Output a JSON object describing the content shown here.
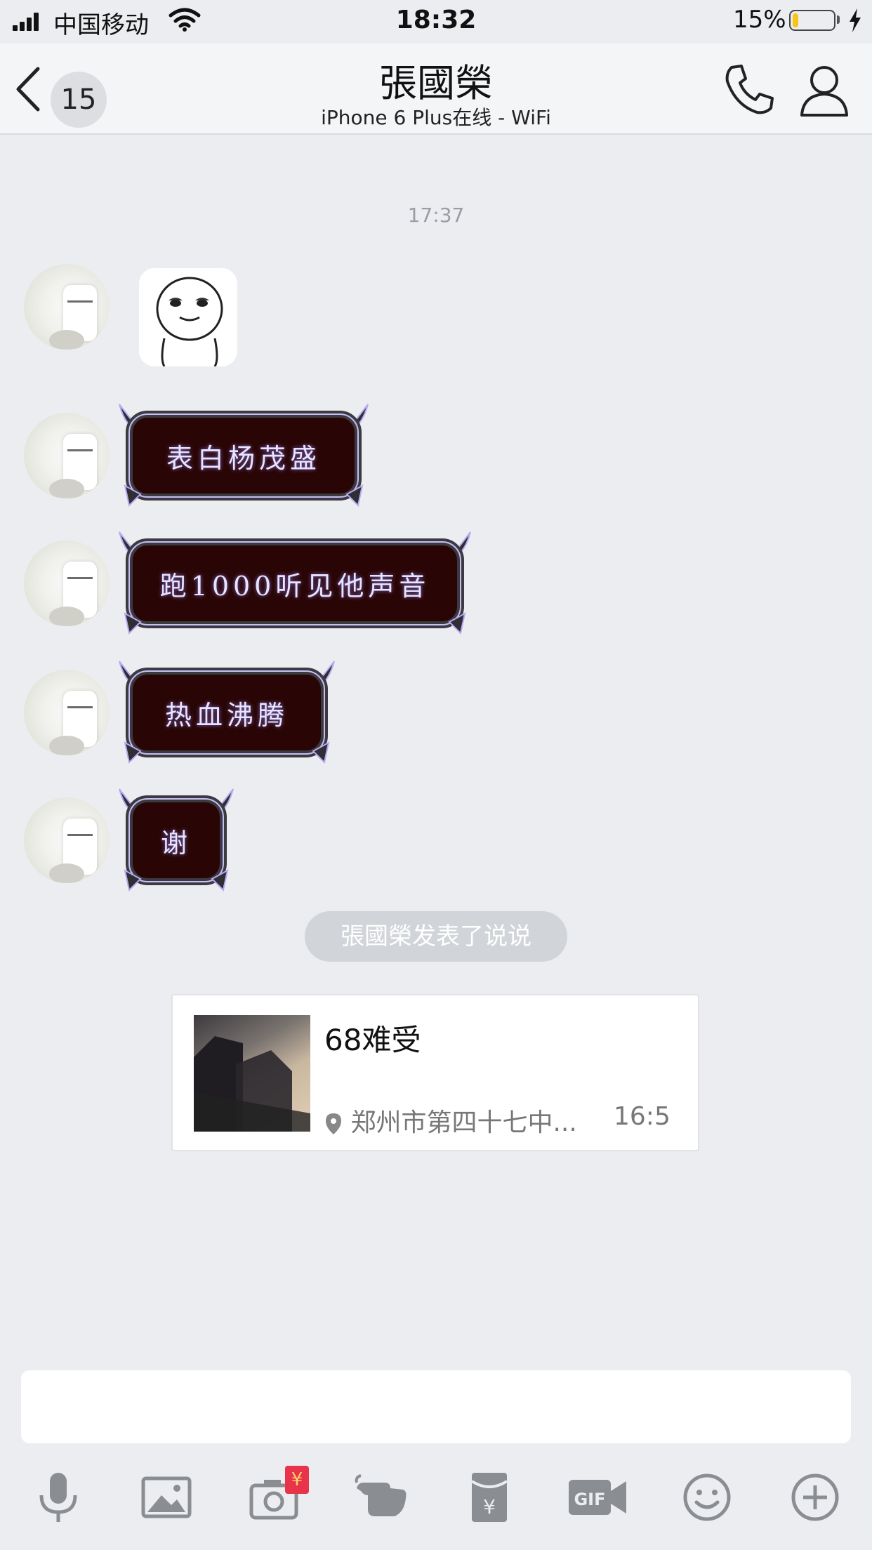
{
  "status_bar": {
    "carrier": "中国移动",
    "time": "18:32",
    "battery_percent": "15%",
    "signal_bars": 4,
    "battery_level": 0.15,
    "charging": true
  },
  "nav": {
    "back_icon": "chevron-left-icon",
    "unread_count": "15",
    "contact_name": "張國榮",
    "contact_status": "iPhone 6 Plus在线 - WiFi",
    "call_icon": "phone-icon",
    "profile_icon": "person-icon"
  },
  "chat": {
    "time_divider": "17:37",
    "messages": [
      {
        "type": "sticker",
        "sender": "張國榮",
        "sticker": "smiling-face-sticker"
      },
      {
        "type": "text",
        "sender": "張國榮",
        "text": "表白杨茂盛"
      },
      {
        "type": "text",
        "sender": "張國榮",
        "text": "跑1000听见他声音"
      },
      {
        "type": "text",
        "sender": "張國榮",
        "text": "热血沸腾"
      },
      {
        "type": "text",
        "sender": "張國榮",
        "text": "谢"
      }
    ],
    "system_notice": "張國榮发表了说说",
    "post_card": {
      "title": "68难受",
      "location": "郑州市第四十七中...",
      "time": "16:5"
    }
  },
  "input": {
    "value": "",
    "toolbar": [
      {
        "icon": "microphone-icon"
      },
      {
        "icon": "image-icon"
      },
      {
        "icon": "camera-icon",
        "badge": "¥"
      },
      {
        "icon": "poke-hand-icon"
      },
      {
        "icon": "red-packet-icon"
      },
      {
        "icon": "gif-icon"
      },
      {
        "icon": "emoji-icon"
      },
      {
        "icon": "plus-icon"
      }
    ]
  },
  "colors": {
    "background": "#ebedf0",
    "bubble_fill": "#2a0505",
    "bubble_frame": "#2e2e33",
    "bubble_text": "#e8e4ff",
    "battery_fill": "#f5c518",
    "badge_red": "#e8334a"
  }
}
